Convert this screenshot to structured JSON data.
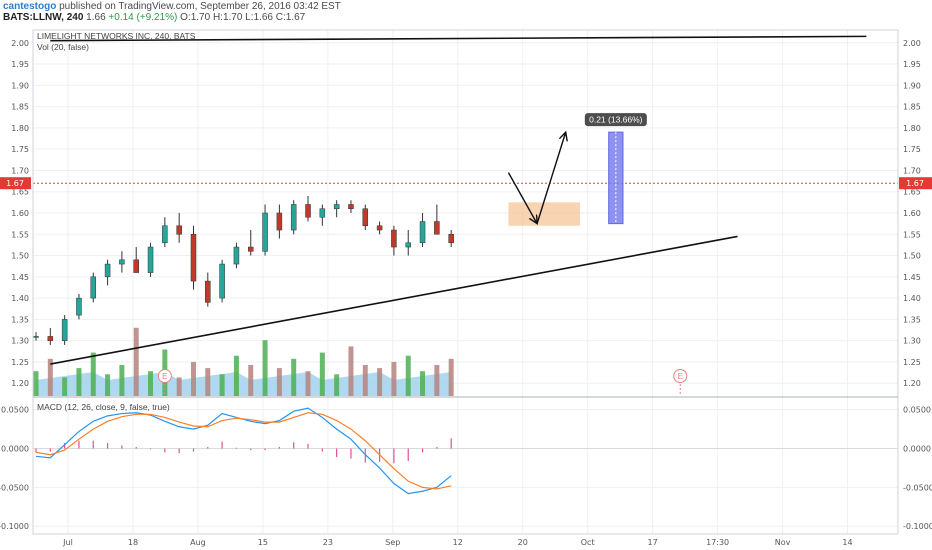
{
  "header": {
    "author": "cantestogo",
    "published_text": "published on TradingView.com, September 26, 2016 03:42 EST",
    "symbol": "BATS:LLNW, 240",
    "last": "1.66",
    "change": "+0.14 (+9.21%)",
    "ohlc": "O:1.70 H:1.70 L:1.66 C:1.67"
  },
  "chart_data": [
    {
      "type": "candlestick",
      "title": "LIMELIGHT NETWORKS INC, 240, BATS",
      "y_range": [
        1.17,
        2.03
      ],
      "y_ticks": [
        "2.00",
        "1.95",
        "1.90",
        "1.85",
        "1.80",
        "1.75",
        "1.70",
        "1.65",
        "1.60",
        "1.55",
        "1.50",
        "1.45",
        "1.40",
        "1.35",
        "1.30",
        "1.25",
        "1.20"
      ],
      "x_ticks": [
        "Jul",
        "18",
        "Aug",
        "15",
        "23",
        "Sep",
        "12",
        "20",
        "Oct",
        "17",
        "17:30",
        "Nov",
        "14"
      ],
      "current_price_label": "1.67",
      "current_price": 1.67,
      "trendlines": [
        {
          "name": "upper-resistance",
          "points": [
            [
              1,
              2.005
            ],
            [
              58,
              2.015
            ]
          ]
        },
        {
          "name": "lower-support",
          "points": [
            [
              1,
              1.245
            ],
            [
              49,
              1.545
            ]
          ]
        }
      ],
      "projection_path": [
        [
          33,
          1.695
        ],
        [
          35,
          1.575
        ],
        [
          37,
          1.79
        ]
      ],
      "orange_zone": {
        "x": [
          33,
          38
        ],
        "y": [
          1.57,
          1.625
        ]
      },
      "measure_box": {
        "x": [
          40,
          41
        ],
        "y": [
          1.575,
          1.79
        ],
        "label": "0.21 (13.66%)"
      },
      "events": [
        {
          "x": 9,
          "label": "E"
        },
        {
          "x": 45,
          "label": "E"
        }
      ],
      "candles": [
        [
          1.31,
          1.32,
          1.3,
          1.31
        ],
        [
          1.31,
          1.33,
          1.29,
          1.3
        ],
        [
          1.3,
          1.36,
          1.29,
          1.35
        ],
        [
          1.36,
          1.41,
          1.35,
          1.4
        ],
        [
          1.4,
          1.46,
          1.39,
          1.45
        ],
        [
          1.45,
          1.49,
          1.43,
          1.48
        ],
        [
          1.48,
          1.51,
          1.46,
          1.49
        ],
        [
          1.49,
          1.52,
          1.47,
          1.46
        ],
        [
          1.46,
          1.53,
          1.45,
          1.52
        ],
        [
          1.53,
          1.59,
          1.52,
          1.57
        ],
        [
          1.57,
          1.6,
          1.53,
          1.55
        ],
        [
          1.55,
          1.57,
          1.42,
          1.44
        ],
        [
          1.44,
          1.46,
          1.38,
          1.39
        ],
        [
          1.4,
          1.49,
          1.39,
          1.48
        ],
        [
          1.48,
          1.53,
          1.47,
          1.52
        ],
        [
          1.52,
          1.56,
          1.5,
          1.51
        ],
        [
          1.51,
          1.62,
          1.5,
          1.6
        ],
        [
          1.6,
          1.62,
          1.54,
          1.56
        ],
        [
          1.56,
          1.63,
          1.55,
          1.62
        ],
        [
          1.62,
          1.64,
          1.58,
          1.59
        ],
        [
          1.59,
          1.62,
          1.57,
          1.61
        ],
        [
          1.61,
          1.63,
          1.59,
          1.62
        ],
        [
          1.62,
          1.63,
          1.6,
          1.61
        ],
        [
          1.61,
          1.62,
          1.56,
          1.57
        ],
        [
          1.57,
          1.58,
          1.55,
          1.56
        ],
        [
          1.56,
          1.57,
          1.5,
          1.52
        ],
        [
          1.52,
          1.56,
          1.5,
          1.53
        ],
        [
          1.53,
          1.6,
          1.52,
          1.58
        ],
        [
          1.58,
          1.62,
          1.56,
          1.55
        ],
        [
          1.55,
          1.56,
          1.52,
          1.53
        ]
      ],
      "volume_bars": [
        8,
        12,
        6,
        9,
        14,
        7,
        10,
        22,
        8,
        15,
        6,
        11,
        9,
        7,
        13,
        10,
        18,
        9,
        12,
        8,
        14,
        7,
        16,
        10,
        9,
        11,
        13,
        8,
        10,
        12
      ]
    },
    {
      "type": "line",
      "title": "MACD (12, 26, close, 9, false, true)",
      "y_range": [
        -0.11,
        0.065
      ],
      "y_ticks": [
        "0.0500",
        "0.0000",
        "-0.0500",
        "-0.1000"
      ],
      "series": [
        {
          "name": "MACD",
          "color": "#2196f3",
          "values": [
            -0.01,
            -0.012,
            0.005,
            0.022,
            0.035,
            0.042,
            0.045,
            0.046,
            0.043,
            0.035,
            0.028,
            0.025,
            0.03,
            0.045,
            0.04,
            0.035,
            0.032,
            0.036,
            0.048,
            0.052,
            0.04,
            0.025,
            0.012,
            -0.008,
            -0.025,
            -0.045,
            -0.058,
            -0.055,
            -0.05,
            -0.035
          ]
        },
        {
          "name": "Signal",
          "color": "#ff7f27",
          "values": [
            -0.005,
            -0.008,
            -0.002,
            0.012,
            0.025,
            0.035,
            0.041,
            0.044,
            0.044,
            0.04,
            0.034,
            0.029,
            0.028,
            0.036,
            0.039,
            0.037,
            0.034,
            0.034,
            0.04,
            0.046,
            0.044,
            0.036,
            0.025,
            0.01,
            -0.008,
            -0.026,
            -0.042,
            -0.05,
            -0.052,
            -0.048
          ]
        }
      ]
    }
  ],
  "colors": {
    "up": "#26a69a",
    "down": "#c0392b",
    "up_vol": "#4caf50",
    "down_vol": "#b5837e",
    "volume_ma_area": "#9ccfee",
    "price_line": "#e53935",
    "orange_zone": "#f5c59a",
    "measure_box": "#7b7ff2"
  },
  "panes": {
    "price_title": "LIMELIGHT NETWORKS INC, 240, BATS",
    "vol_title": "Vol (20, false)",
    "macd_title": "MACD (12, 26, close, 9, false, true)"
  }
}
